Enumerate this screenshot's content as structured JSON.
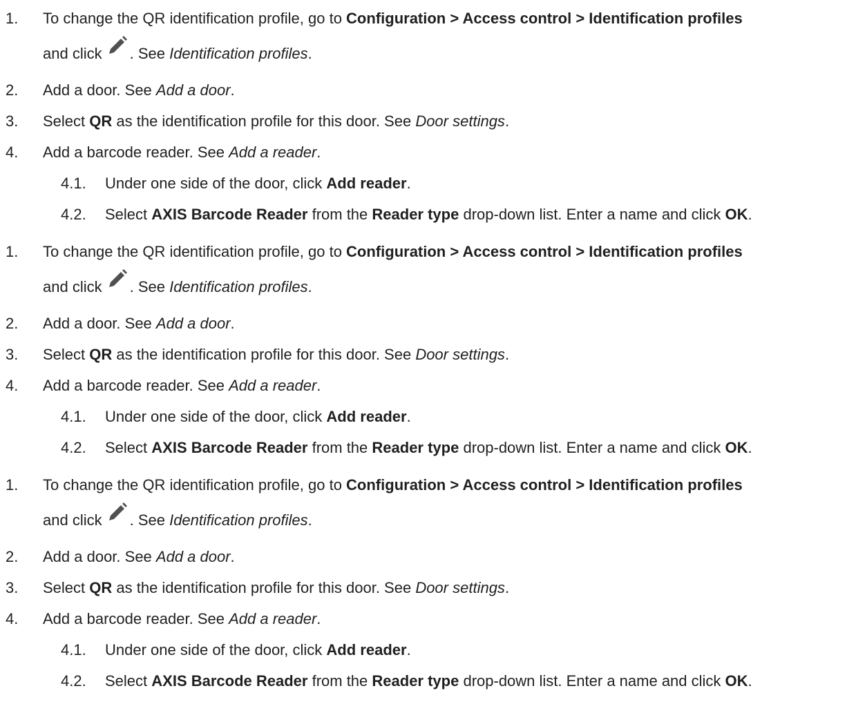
{
  "blocks": [
    {
      "step1": {
        "num": "1.",
        "pre": "To change the QR identification profile, go to ",
        "path": "Configuration > Access control > Identification profiles",
        "cont_pre": "and click",
        "cont_post": ". See ",
        "link": "Identification profiles",
        "end": "."
      },
      "step2": {
        "num": "2.",
        "pre": "Add a door. See ",
        "link": "Add a door",
        "end": "."
      },
      "step3": {
        "num": "3.",
        "pre": "Select ",
        "bold": "QR",
        "mid": " as the identification profile for this door. See ",
        "link": "Door settings",
        "end": "."
      },
      "step4": {
        "num": "4.",
        "pre": "Add a barcode reader. See ",
        "link": "Add a reader",
        "end": "."
      },
      "step41": {
        "num": "4.1.",
        "pre": "Under one side of the door, click ",
        "bold": "Add reader",
        "end": "."
      },
      "step42": {
        "num": "4.2.",
        "pre": "Select ",
        "bold1": "AXIS Barcode Reader",
        "mid1": " from the ",
        "bold2": "Reader type",
        "mid2": " drop-down list. Enter a name and click ",
        "bold3": "OK",
        "end": "."
      }
    },
    {
      "step1": {
        "num": "1.",
        "pre": "To change the QR identification profile, go to ",
        "path": "Configuration > Access control > Identification profiles",
        "cont_pre": "and click",
        "cont_post": ". See ",
        "link": "Identification profiles",
        "end": "."
      },
      "step2": {
        "num": "2.",
        "pre": "Add a door. See ",
        "link": "Add a door",
        "end": "."
      },
      "step3": {
        "num": "3.",
        "pre": "Select ",
        "bold": "QR",
        "mid": " as the identification profile for this door. See ",
        "link": "Door settings",
        "end": "."
      },
      "step4": {
        "num": "4.",
        "pre": "Add a barcode reader. See ",
        "link": "Add a reader",
        "end": "."
      },
      "step41": {
        "num": "4.1.",
        "pre": "Under one side of the door, click ",
        "bold": "Add reader",
        "end": "."
      },
      "step42": {
        "num": "4.2.",
        "pre": "Select ",
        "bold1": "AXIS Barcode Reader",
        "mid1": " from the ",
        "bold2": "Reader type",
        "mid2": " drop-down list. Enter a name and click ",
        "bold3": "OK",
        "end": "."
      }
    },
    {
      "step1": {
        "num": "1.",
        "pre": "To change the QR identification profile, go to ",
        "path": "Configuration > Access control > Identification profiles",
        "cont_pre": "and click",
        "cont_post": ". See ",
        "link": "Identification profiles",
        "end": "."
      },
      "step2": {
        "num": "2.",
        "pre": "Add a door. See ",
        "link": "Add a door",
        "end": "."
      },
      "step3": {
        "num": "3.",
        "pre": "Select ",
        "bold": "QR",
        "mid": " as the identification profile for this door. See ",
        "link": "Door settings",
        "end": "."
      },
      "step4": {
        "num": "4.",
        "pre": "Add a barcode reader. See ",
        "link": "Add a reader",
        "end": "."
      },
      "step41": {
        "num": "4.1.",
        "pre": "Under one side of the door, click ",
        "bold": "Add reader",
        "end": "."
      },
      "step42": {
        "num": "4.2.",
        "pre": "Select ",
        "bold1": "AXIS Barcode Reader",
        "mid1": " from the ",
        "bold2": "Reader type",
        "mid2": " drop-down list. Enter a name and click ",
        "bold3": "OK",
        "end": "."
      }
    }
  ],
  "icons": {
    "edit": "pencil-icon",
    "edit_color": "#505050"
  }
}
